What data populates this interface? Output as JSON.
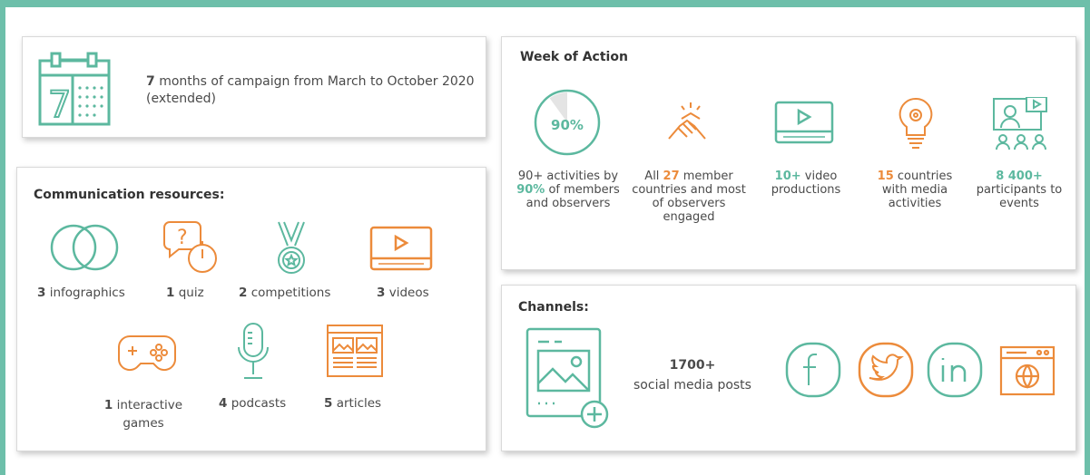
{
  "colors": {
    "frame": "#6dbfaa",
    "teal": "#5cb89f",
    "orange": "#ec8b3b",
    "text": "#4a4a4a"
  },
  "campaign": {
    "number": "7",
    "text": "months of campaign from March to October 2020 (extended)",
    "icon": "calendar-icon",
    "calendar_day": "7"
  },
  "resources": {
    "title": "Communication resources:",
    "items": [
      {
        "num": "3",
        "label": "infographics",
        "icon": "venn-circles-icon"
      },
      {
        "num": "1",
        "label": "quiz",
        "icon": "quiz-timer-icon"
      },
      {
        "num": "2",
        "label": "competitions",
        "icon": "medal-icon"
      },
      {
        "num": "3",
        "label": "videos",
        "icon": "video-player-icon"
      },
      {
        "num": "1",
        "label": "interactive games",
        "icon": "gamepad-icon"
      },
      {
        "num": "4",
        "label": "podcasts",
        "icon": "microphone-icon"
      },
      {
        "num": "5",
        "label": "articles",
        "icon": "articles-icon"
      }
    ]
  },
  "week": {
    "title": "Week of Action",
    "pie_value": "90%",
    "pie_fraction": 0.9,
    "items": [
      {
        "pre": "90+ activities by ",
        "num": "90%",
        "post": " of members and observers",
        "icon": "pie-icon"
      },
      {
        "pre": "All ",
        "num": "27",
        "post": " member countries and most of observers engaged",
        "icon": "handshake-icon"
      },
      {
        "pre": "",
        "num": "10+",
        "post": " video productions",
        "icon": "video-player-icon"
      },
      {
        "pre": "",
        "num": "15",
        "post": " countries with media activities",
        "icon": "lightbulb-gear-icon"
      },
      {
        "pre": "",
        "num": "8 400+",
        "post": " participants to events",
        "icon": "presentation-audience-icon"
      }
    ]
  },
  "channels": {
    "title": "Channels:",
    "count": "1700+",
    "label": "social media posts",
    "icons": [
      "social-post-icon",
      "facebook-icon",
      "twitter-icon",
      "linkedin-icon",
      "web-icon"
    ]
  }
}
